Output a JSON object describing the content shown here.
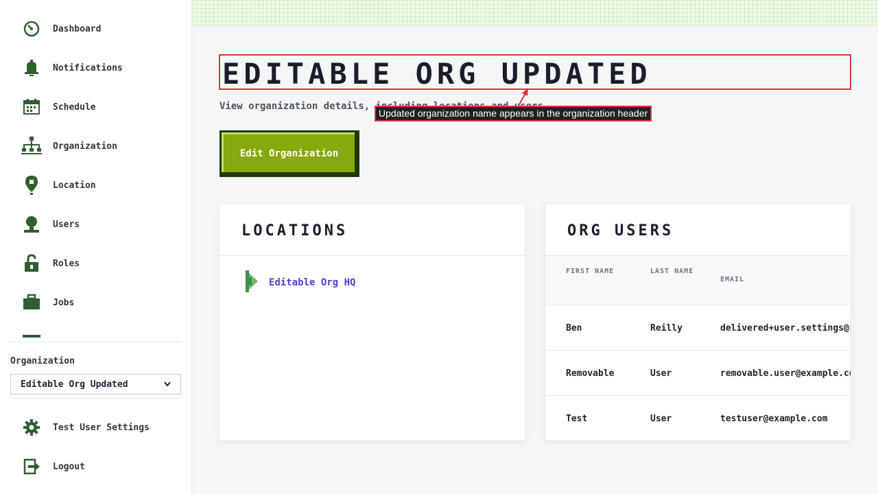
{
  "sidebar": {
    "items": [
      {
        "label": "Dashboard",
        "icon": "dashboard-gauge-icon"
      },
      {
        "label": "Notifications",
        "icon": "bell-icon"
      },
      {
        "label": "Schedule",
        "icon": "calendar-icon"
      },
      {
        "label": "Organization",
        "icon": "org-chart-icon"
      },
      {
        "label": "Location",
        "icon": "map-pin-icon"
      },
      {
        "label": "Users",
        "icon": "user-icon"
      },
      {
        "label": "Roles",
        "icon": "lock-icon"
      },
      {
        "label": "Jobs",
        "icon": "briefcase-icon"
      }
    ],
    "org_label": "Organization",
    "org_selected": "Editable Org Updated",
    "settings_label": "Test User Settings",
    "logout_label": "Logout"
  },
  "header": {
    "title": "Editable Org Updated",
    "subtitle": "View organization details, including locations and users",
    "edit_button": "Edit Organization"
  },
  "annotation": {
    "text": "Updated organization name appears in the organization header",
    "color": "#e0353b"
  },
  "locations": {
    "title": "Locations",
    "items": [
      "Editable Org HQ"
    ]
  },
  "org_users": {
    "title": "Org Users",
    "columns": [
      "First Name",
      "Last Name",
      "Email"
    ],
    "rows": [
      {
        "first": "Ben",
        "last": "Reilly",
        "email": "delivered+user.settings@resend.dev"
      },
      {
        "first": "Removable",
        "last": "User",
        "email": "removable.user@example.com"
      },
      {
        "first": "Test",
        "last": "User",
        "email": "testuser@example.com"
      }
    ]
  },
  "colors": {
    "accent": "#87a90e",
    "accent_dark": "#1d3a06",
    "icon": "#2f5e2f",
    "link": "#4b3fd6"
  }
}
